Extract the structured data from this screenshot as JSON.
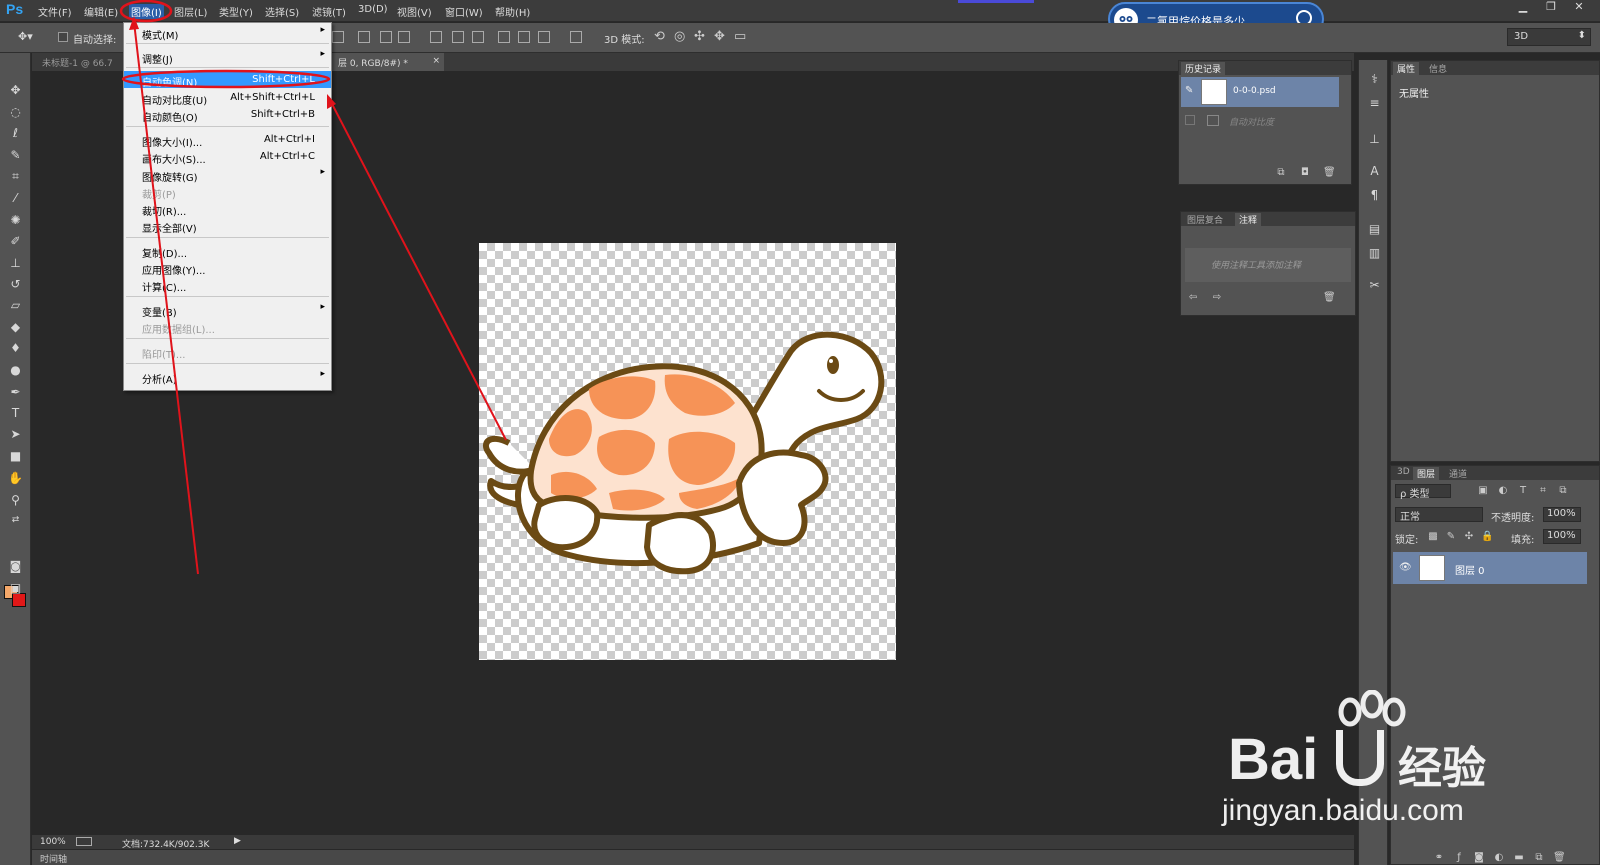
{
  "app": {
    "logo": "Ps"
  },
  "menubar": {
    "items": [
      "文件(F)",
      "编辑(E)",
      "图像(I)",
      "图层(L)",
      "类型(Y)",
      "选择(S)",
      "滤镜(T)",
      "3D(D)",
      "视图(V)",
      "窗口(W)",
      "帮助(H)"
    ],
    "active": "图像(I)"
  },
  "search_widget": {
    "query": "二氯甲烷价格是多少",
    "icon": "search-icon"
  },
  "window_controls": {
    "minimize": "▁",
    "restore": "❐",
    "close": "✕"
  },
  "options_bar": {
    "auto_select_label": "自动选择:",
    "mode3d_label": "3D 模式:",
    "workspace_dropdown": "3D"
  },
  "document_tabs": [
    {
      "label": "未标题-1 @ 66.7"
    },
    {
      "label": "层 0, RGB/8#) *"
    }
  ],
  "image_menu": {
    "items": [
      {
        "label": "模式(M)",
        "shortcut": "",
        "submenu": true,
        "disabled": false,
        "highlighted": false
      },
      {
        "label": "调整(J)",
        "shortcut": "",
        "submenu": true,
        "disabled": false,
        "highlighted": false
      },
      {
        "label": "自动色调(N)",
        "shortcut": "Shift+Ctrl+L",
        "submenu": false,
        "disabled": false,
        "highlighted": true
      },
      {
        "label": "自动对比度(U)",
        "shortcut": "Alt+Shift+Ctrl+L",
        "submenu": false,
        "disabled": false,
        "highlighted": false
      },
      {
        "label": "自动颜色(O)",
        "shortcut": "Shift+Ctrl+B",
        "submenu": false,
        "disabled": false,
        "highlighted": false
      },
      {
        "label": "图像大小(I)...",
        "shortcut": "Alt+Ctrl+I",
        "submenu": false,
        "disabled": false,
        "highlighted": false
      },
      {
        "label": "画布大小(S)...",
        "shortcut": "Alt+Ctrl+C",
        "submenu": false,
        "disabled": false,
        "highlighted": false
      },
      {
        "label": "图像旋转(G)",
        "shortcut": "",
        "submenu": true,
        "disabled": false,
        "highlighted": false
      },
      {
        "label": "裁剪(P)",
        "shortcut": "",
        "submenu": false,
        "disabled": true,
        "highlighted": false
      },
      {
        "label": "裁切(R)...",
        "shortcut": "",
        "submenu": false,
        "disabled": false,
        "highlighted": false
      },
      {
        "label": "显示全部(V)",
        "shortcut": "",
        "submenu": false,
        "disabled": false,
        "highlighted": false
      },
      {
        "label": "复制(D)...",
        "shortcut": "",
        "submenu": false,
        "disabled": false,
        "highlighted": false
      },
      {
        "label": "应用图像(Y)...",
        "shortcut": "",
        "submenu": false,
        "disabled": false,
        "highlighted": false
      },
      {
        "label": "计算(C)...",
        "shortcut": "",
        "submenu": false,
        "disabled": false,
        "highlighted": false
      },
      {
        "label": "变量(B)",
        "shortcut": "",
        "submenu": true,
        "disabled": false,
        "highlighted": false
      },
      {
        "label": "应用数据组(L)...",
        "shortcut": "",
        "submenu": false,
        "disabled": true,
        "highlighted": false
      },
      {
        "label": "陷印(T)...",
        "shortcut": "",
        "submenu": false,
        "disabled": true,
        "highlighted": false
      },
      {
        "label": "分析(A)",
        "shortcut": "",
        "submenu": true,
        "disabled": false,
        "highlighted": false
      }
    ],
    "submenu_arrow": "▸"
  },
  "history_panel": {
    "tab": "历史记录",
    "entries": [
      {
        "label": "0-0-0.psd",
        "active": true
      },
      {
        "label": "自动对比度",
        "active": false
      }
    ]
  },
  "notes_panel": {
    "tabs": [
      "图层复合",
      "注释"
    ],
    "active_tab": "注释",
    "placeholder": "使用注释工具添加注释"
  },
  "properties_panel": {
    "tabs": [
      "属性",
      "信息"
    ],
    "active_tab": "属性",
    "content": "无属性"
  },
  "layers_panel": {
    "tabs": [
      "3D",
      "图层",
      "通道"
    ],
    "active_tab": "图层",
    "filter_label": "ρ 类型",
    "blend_mode": "正常",
    "opacity_label": "不透明度:",
    "opacity_value": "100%",
    "lock_label": "锁定:",
    "fill_label": "填充:",
    "fill_value": "100%",
    "layers": [
      {
        "name": "图层 0",
        "visible": true
      }
    ]
  },
  "status_bar": {
    "zoom": "100%",
    "doc_info": "文档:732.4K/902.3K"
  },
  "timeline_label": "时间轴",
  "watermark": {
    "brand": "Bai",
    "brand_tail": "经验",
    "url": "jingyan.baidu.com"
  },
  "colors": {
    "foreground": "#f4a86a",
    "background": "#e11818",
    "annotation_red": "#e0131b",
    "menu_highlight": "#3399ff"
  }
}
